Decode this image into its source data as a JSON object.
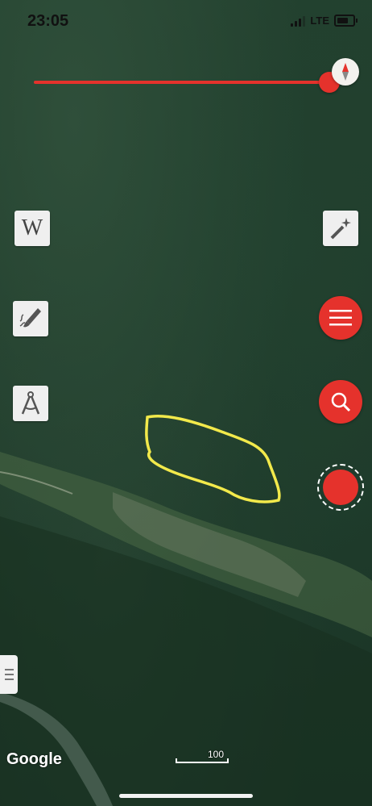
{
  "status_bar": {
    "time": "23:05",
    "network": "LTE"
  },
  "map": {
    "attribution": "Google",
    "scale_label": "100",
    "annotation_color": "#f2e94b"
  },
  "toolbar": {
    "wiki_label": "W"
  },
  "colors": {
    "accent": "#e5322c",
    "button_bg": "#efefef"
  },
  "icons": {
    "compass": "compass-icon",
    "wikipedia": "wikipedia-icon",
    "draw": "brush-icon",
    "measure": "compass-tool-icon",
    "magic": "magic-wand-icon",
    "menu": "hamburger-menu-icon",
    "search": "search-icon",
    "record": "record-icon"
  }
}
